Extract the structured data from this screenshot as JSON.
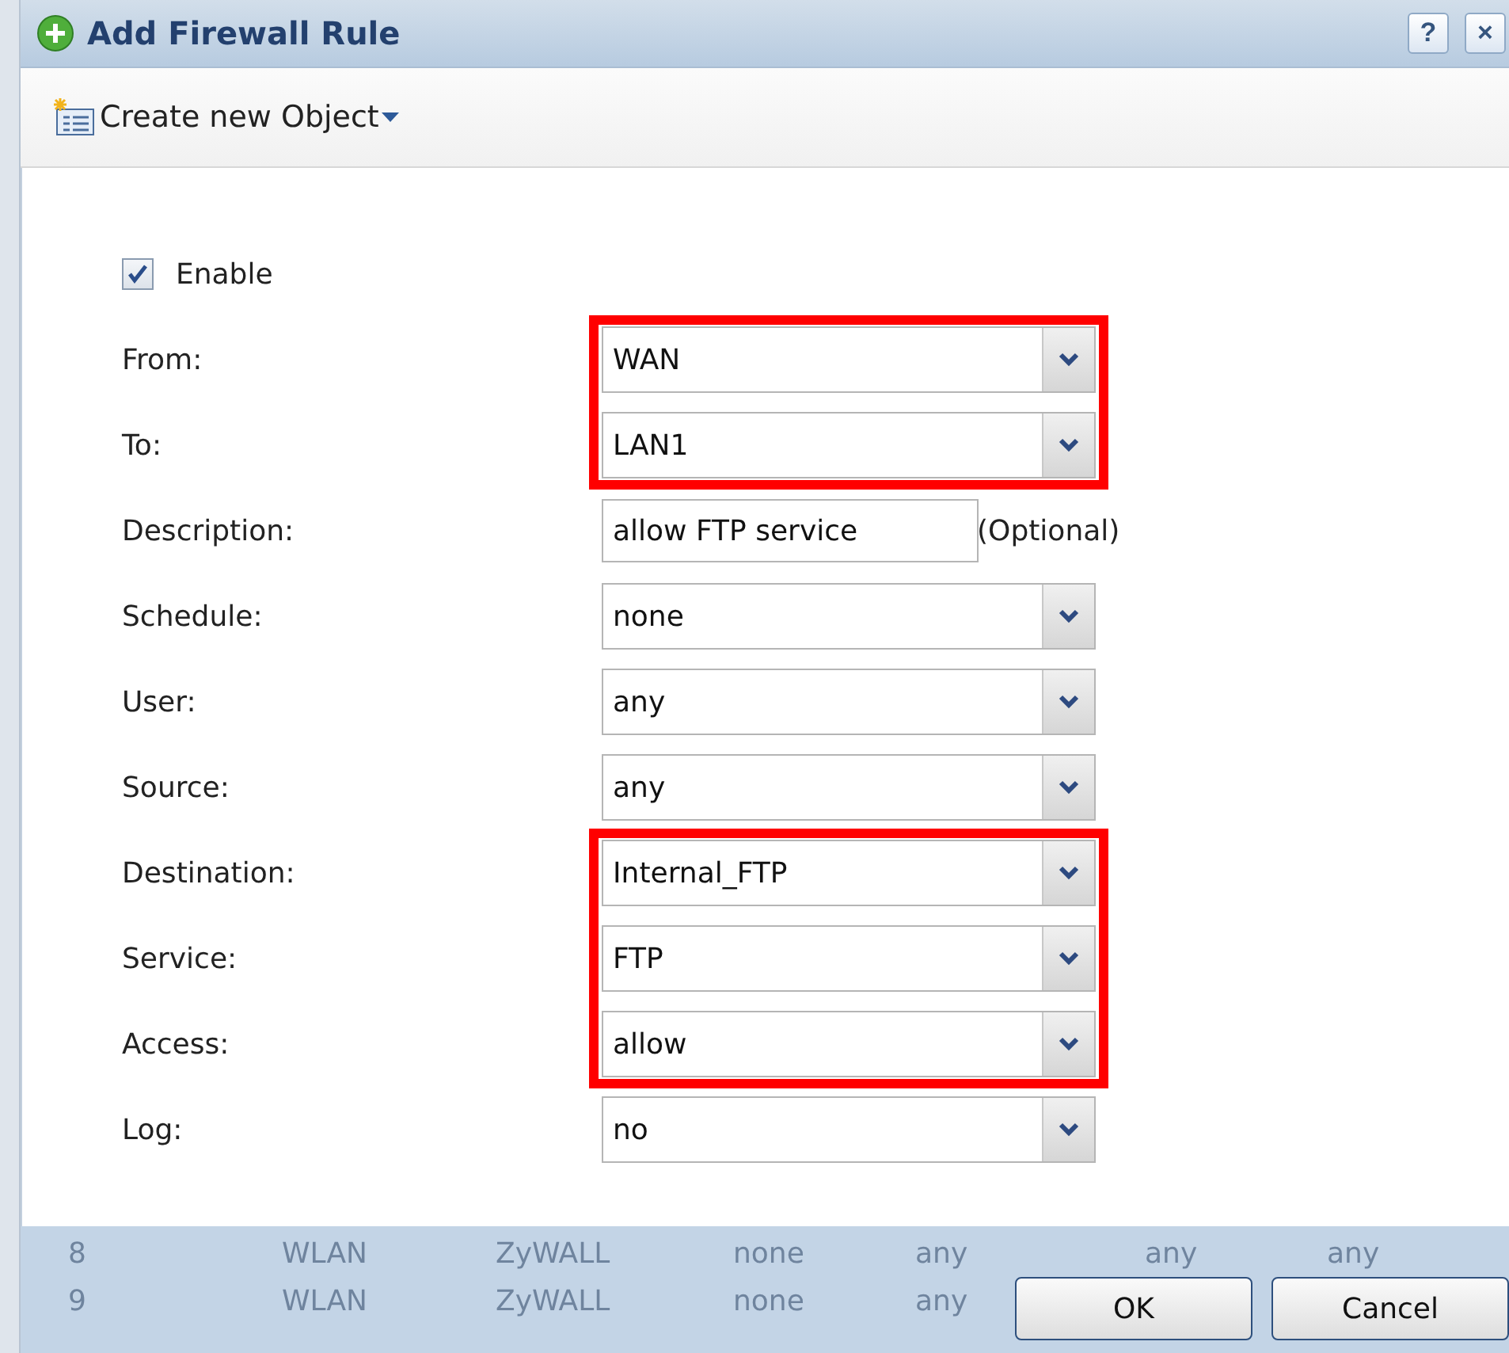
{
  "window": {
    "title": "Add Firewall Rule",
    "help": "?",
    "close": "×"
  },
  "toolbar": {
    "menu": "Create new Object"
  },
  "enable": {
    "label": "Enable",
    "checked": true
  },
  "fields": [
    {
      "kind": "select",
      "label": "From:",
      "value": "WAN",
      "highlighted": true
    },
    {
      "kind": "select",
      "label": "To:",
      "value": "LAN1",
      "highlighted": true
    },
    {
      "kind": "text",
      "label": "Description:",
      "value": "allow FTP service",
      "note": "(Optional)",
      "highlighted": false
    },
    {
      "kind": "select",
      "label": "Schedule:",
      "value": "none",
      "highlighted": false
    },
    {
      "kind": "select",
      "label": "User:",
      "value": "any",
      "highlighted": false
    },
    {
      "kind": "select",
      "label": "Source:",
      "value": "any",
      "highlighted": false
    },
    {
      "kind": "select",
      "label": "Destination:",
      "value": "Internal_FTP",
      "highlighted": true
    },
    {
      "kind": "select",
      "label": "Service:",
      "value": "FTP",
      "highlighted": true
    },
    {
      "kind": "select",
      "label": "Access:",
      "value": "allow",
      "highlighted": true
    },
    {
      "kind": "select",
      "label": "Log:",
      "value": "no",
      "highlighted": false
    }
  ],
  "background_rows": [
    [
      "8",
      "WLAN",
      "ZyWALL",
      "none",
      "any",
      "any",
      "any"
    ],
    [
      "9",
      "WLAN",
      "ZyWALL",
      "none",
      "any"
    ]
  ],
  "buttons": [
    "OK",
    "Cancel"
  ]
}
